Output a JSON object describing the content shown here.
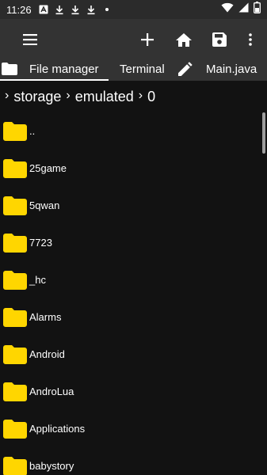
{
  "status_bar": {
    "time": "11:26",
    "icons": [
      "notification-a-icon",
      "download-icon",
      "download-icon",
      "download-icon",
      "dot-icon"
    ],
    "right_icons": [
      "wifi-icon",
      "signal-icon",
      "battery-icon"
    ]
  },
  "toolbar": {
    "menu_icon": "menu-icon",
    "actions": [
      "add-icon",
      "home-icon",
      "save-icon",
      "more-vert-icon"
    ]
  },
  "tabs": [
    {
      "label": "File manager",
      "icon": "folder-icon",
      "active": true
    },
    {
      "label": "Terminal",
      "icon": "",
      "active": false
    },
    {
      "label": "Main.java",
      "icon": "pencil-icon",
      "active": false
    }
  ],
  "breadcrumb": [
    "storage",
    "emulated",
    "0"
  ],
  "files": [
    {
      "name": ".."
    },
    {
      "name": "25game"
    },
    {
      "name": "5qwan"
    },
    {
      "name": "7723"
    },
    {
      "name": "_hc"
    },
    {
      "name": "Alarms"
    },
    {
      "name": "Android"
    },
    {
      "name": "AndroLua"
    },
    {
      "name": "Applications"
    },
    {
      "name": "babystory"
    }
  ],
  "colors": {
    "status_bar": "#2b2b2b",
    "toolbar": "#333333",
    "background": "#121212",
    "folder": "#ffd600",
    "text": "#ffffff"
  }
}
